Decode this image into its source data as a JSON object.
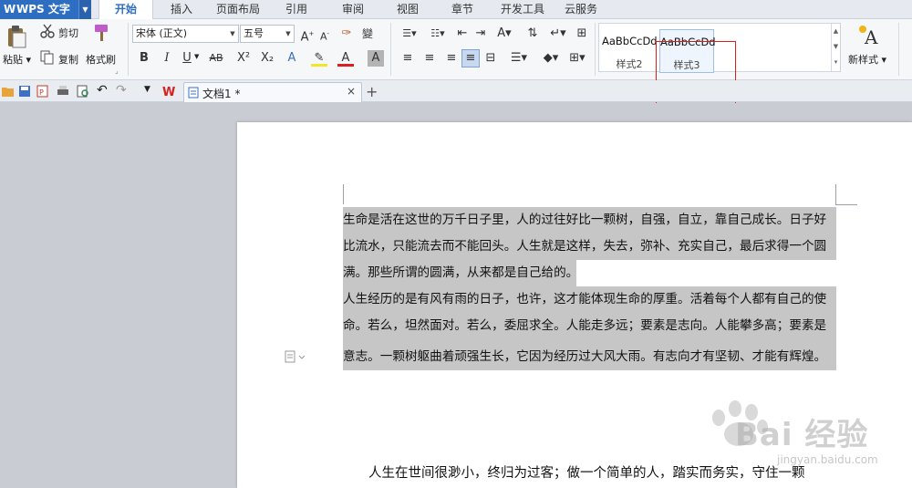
{
  "app": {
    "name": "WPS 文字",
    "logo_glyph": "W"
  },
  "menu": {
    "tabs": [
      {
        "label": "开始",
        "active": true
      },
      {
        "label": "插入"
      },
      {
        "label": "页面布局"
      },
      {
        "label": "引用"
      },
      {
        "label": "审阅"
      },
      {
        "label": "视图"
      },
      {
        "label": "章节"
      },
      {
        "label": "开发工具"
      },
      {
        "label": "云服务"
      }
    ]
  },
  "ribbon": {
    "paste_label": "粘贴",
    "cut_label": "剪切",
    "copy_label": "复制",
    "format_painter_label": "格式刷",
    "font_name": "宋体 (正文)",
    "font_size": "五号",
    "bold": "B",
    "italic": "I",
    "underline": "U",
    "strike": "AB",
    "superscript": "X²",
    "subscript": "X₂",
    "styles": [
      {
        "preview": "AaBbCcDd",
        "name": "样式2"
      },
      {
        "preview": "AaBbCcDd",
        "name": "样式3"
      }
    ],
    "new_style_label": "新样式"
  },
  "tabs": {
    "doc_title": "文档1 *",
    "close_glyph": "×",
    "new_tab_glyph": "+"
  },
  "document": {
    "selected_lines": [
      "生命是活在这世的万千日子里，人的过往好比一颗树，自强，自立，靠自己成长。日子好",
      "比流水，只能流去而不能回头。人生就是这样，失去，弥补、充实自己，最后求得一个圆",
      "满。那些所谓的圆满，从来都是自己给的。",
      "人生经历的是有风有雨的日子，也许，这才能体现生命的厚重。活着每个人都有自己的使",
      "命。若么，坦然面对。若么，委屈求全。人能走多远；要素是志向。人能攀多高；要素是",
      "意志。一颗树躯曲着顽强生长，它因为经历过大风大雨。有志向才有坚韧、才能有辉煌。"
    ],
    "plain_paragraph": "人生在世间很渺小，终归为过客；做一个简单的人，踏实而务实，守住一颗"
  },
  "watermark": {
    "text": "Bai 经验",
    "url": "jingyan.baidu.com"
  },
  "colors": {
    "accent": "#2e6ec2",
    "selection": "#c6c6c6",
    "highlight_box": "#d9201c"
  }
}
